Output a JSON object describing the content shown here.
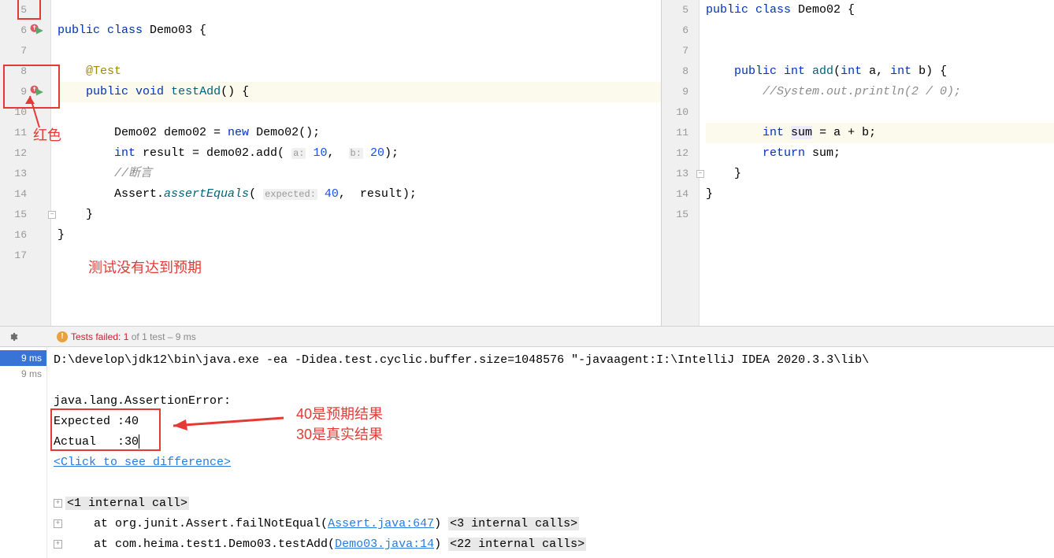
{
  "left_editor": {
    "lines": [
      {
        "num": "5",
        "code": ""
      },
      {
        "num": "6",
        "code_html": "<span class='kw'>public class</span> Demo03 {",
        "run_icon": true
      },
      {
        "num": "7",
        "code": ""
      },
      {
        "num": "8",
        "code_html": "    <span class='ann'>@Test</span>"
      },
      {
        "num": "9",
        "code_html": "    <span class='kw'>public void</span> <span class='method'>testAdd</span>() {",
        "run_icon": true,
        "hl": true
      },
      {
        "num": "10",
        "code": ""
      },
      {
        "num": "11",
        "code_html": "        Demo02 demo02 = <span class='kw'>new</span> Demo02();"
      },
      {
        "num": "12",
        "code_html": "        <span class='kw'>int</span> result = demo02.add( <span class='hint'>a:</span> <span class='num'>10</span>,  <span class='hint'>b:</span> <span class='num'>20</span>);"
      },
      {
        "num": "13",
        "code_html": "        <span class='comment'>//断言</span>"
      },
      {
        "num": "14",
        "code_html": "        Assert.<span class='methoditalic'>assertEquals</span>( <span class='hint'>expected:</span> <span class='num'>40</span>,  result);"
      },
      {
        "num": "15",
        "code": "    }",
        "fold": true
      },
      {
        "num": "16",
        "code": "}"
      },
      {
        "num": "17",
        "code": ""
      }
    ]
  },
  "right_editor": {
    "lines": [
      {
        "num": "5",
        "code_html": "<span class='kw'>public class</span> Demo02 {"
      },
      {
        "num": "6",
        "code": ""
      },
      {
        "num": "7",
        "code": ""
      },
      {
        "num": "8",
        "code_html": "    <span class='kw'>public int</span> <span class='method'>add</span>(<span class='kw'>int</span> a, <span class='kw'>int</span> b) {"
      },
      {
        "num": "9",
        "code_html": "        <span class='comment'>//System.out.println(2 / 0);</span>"
      },
      {
        "num": "10",
        "code": ""
      },
      {
        "num": "11",
        "code_html": "        <span class='kw'>int</span> <span class='varhl'>sum</span> = a + b;",
        "hl": true
      },
      {
        "num": "12",
        "code_html": "        <span class='kw'>return</span> sum;"
      },
      {
        "num": "13",
        "code": "    }",
        "fold": true
      },
      {
        "num": "14",
        "code": "}"
      },
      {
        "num": "15",
        "code": ""
      }
    ]
  },
  "annotations": {
    "red_label_1": "红色",
    "red_label_2": "测试没有达到预期",
    "red_label_3": "40是预期结果",
    "red_label_4": "30是真实结果"
  },
  "test_panel": {
    "failed_prefix": "Tests failed:",
    "failed_count": "1",
    "failed_suffix": "of 1 test – 9 ms",
    "time1": "9 ms",
    "time2": "9 ms"
  },
  "console": {
    "cmd": "D:\\develop\\jdk12\\bin\\java.exe -ea -Didea.test.cyclic.buffer.size=1048576 \"-javaagent:I:\\IntelliJ IDEA 2020.3.3\\lib\\",
    "error": "java.lang.AssertionError:",
    "expected": "Expected :40",
    "actual": "Actual   :30",
    "diff_link": "<Click to see difference>",
    "internal1": "<1 internal call>",
    "trace1_pre": "    at org.junit.Assert.failNotEqual(",
    "trace1_link": "Assert.java:647",
    "trace1_post": ") ",
    "trace1_calls": "<3 internal calls>",
    "trace2_pre": "    at com.heima.test1.Demo03.testAdd(",
    "trace2_link": "Demo03.java:14",
    "trace2_post": ") ",
    "trace2_calls": "<22 internal calls>"
  }
}
